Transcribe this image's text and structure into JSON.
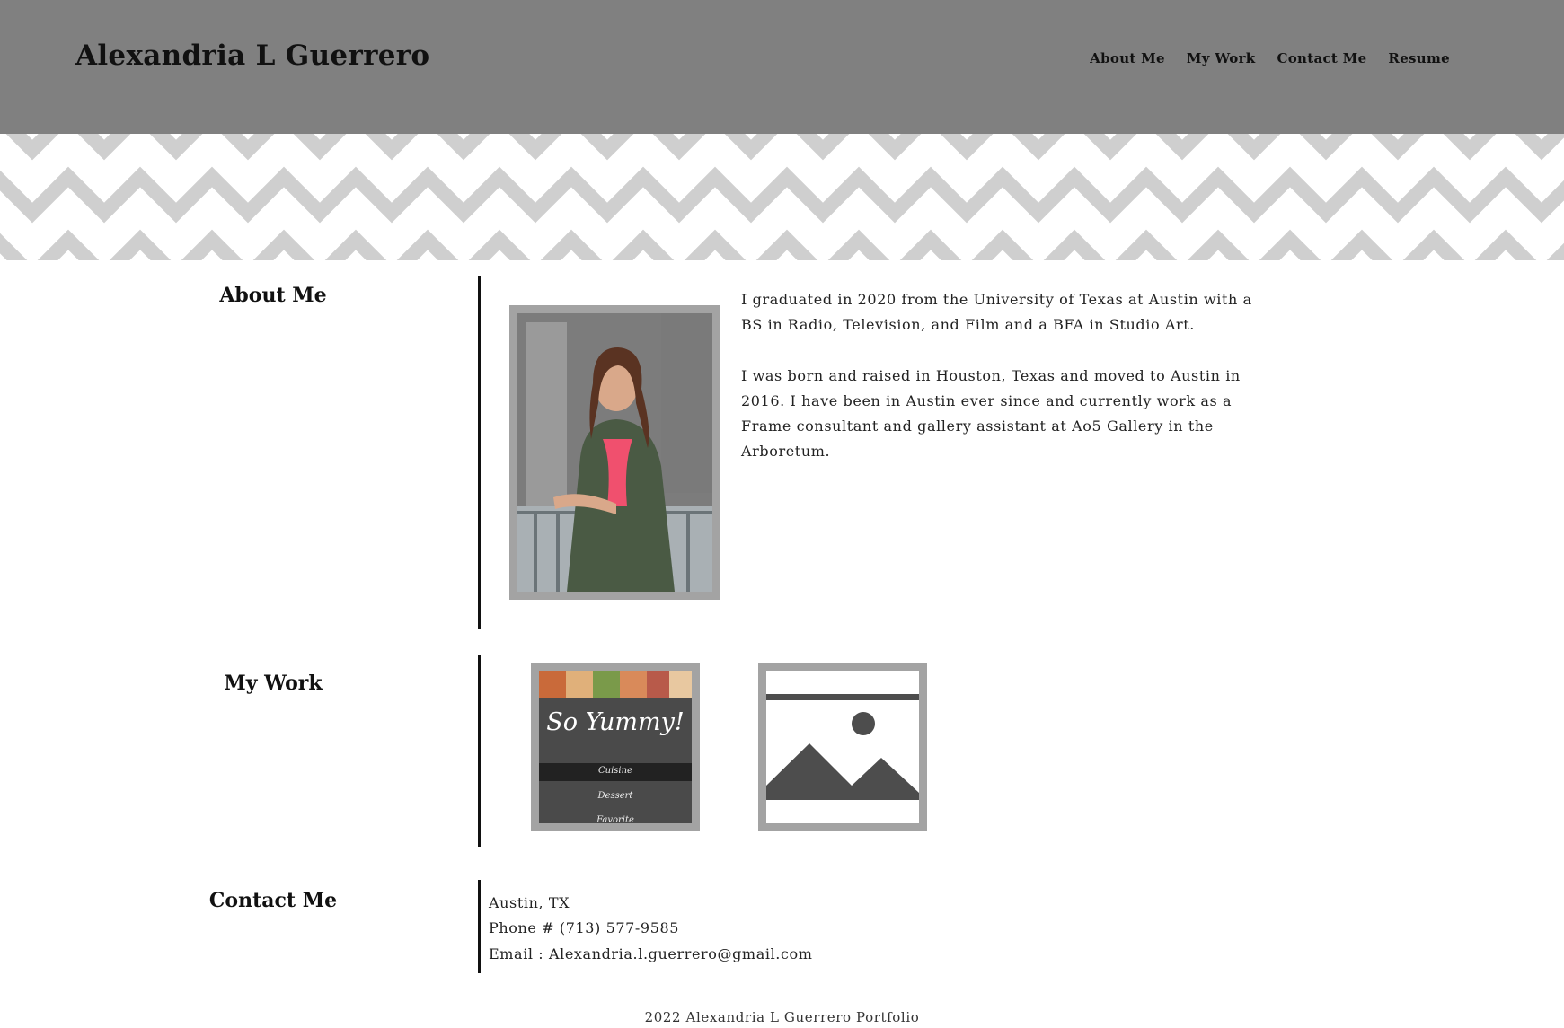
{
  "header": {
    "site_title": "Alexandria L Guerrero",
    "nav": [
      "About Me",
      "My Work",
      "Contact Me",
      "Resume"
    ]
  },
  "about": {
    "heading": "About Me",
    "paragraphs": [
      "I graduated in 2020 from the University of Texas at Austin with a BS in Radio, Television, and Film and a BFA in Studio Art.",
      "I was born and raised in Houston, Texas and moved to Austin in 2016. I have been in Austin ever since and currently work as a Frame consultant and gallery assistant at Ao5 Gallery in the Arboretum."
    ]
  },
  "work": {
    "heading": "My Work",
    "items": [
      {
        "kind": "so-yummy-app",
        "script_title": "So Yummy!",
        "menu": [
          "Cuisine",
          "Dessert",
          "Favorite"
        ]
      },
      {
        "kind": "image-placeholder"
      }
    ]
  },
  "contact": {
    "heading": "Contact Me",
    "location": "Austin, TX",
    "phone": "Phone # (713) 577-9585",
    "email": "Email : Alexandria.l.guerrero@gmail.com"
  },
  "footer": {
    "text": "2022 Alexandria L Guerrero Portfolio"
  },
  "colors": {
    "header_bg": "#808080",
    "chevron_gray": "#cfcfcf",
    "frame_gray": "#a3a3a3",
    "placeholder_dark": "#4d4d4d"
  }
}
